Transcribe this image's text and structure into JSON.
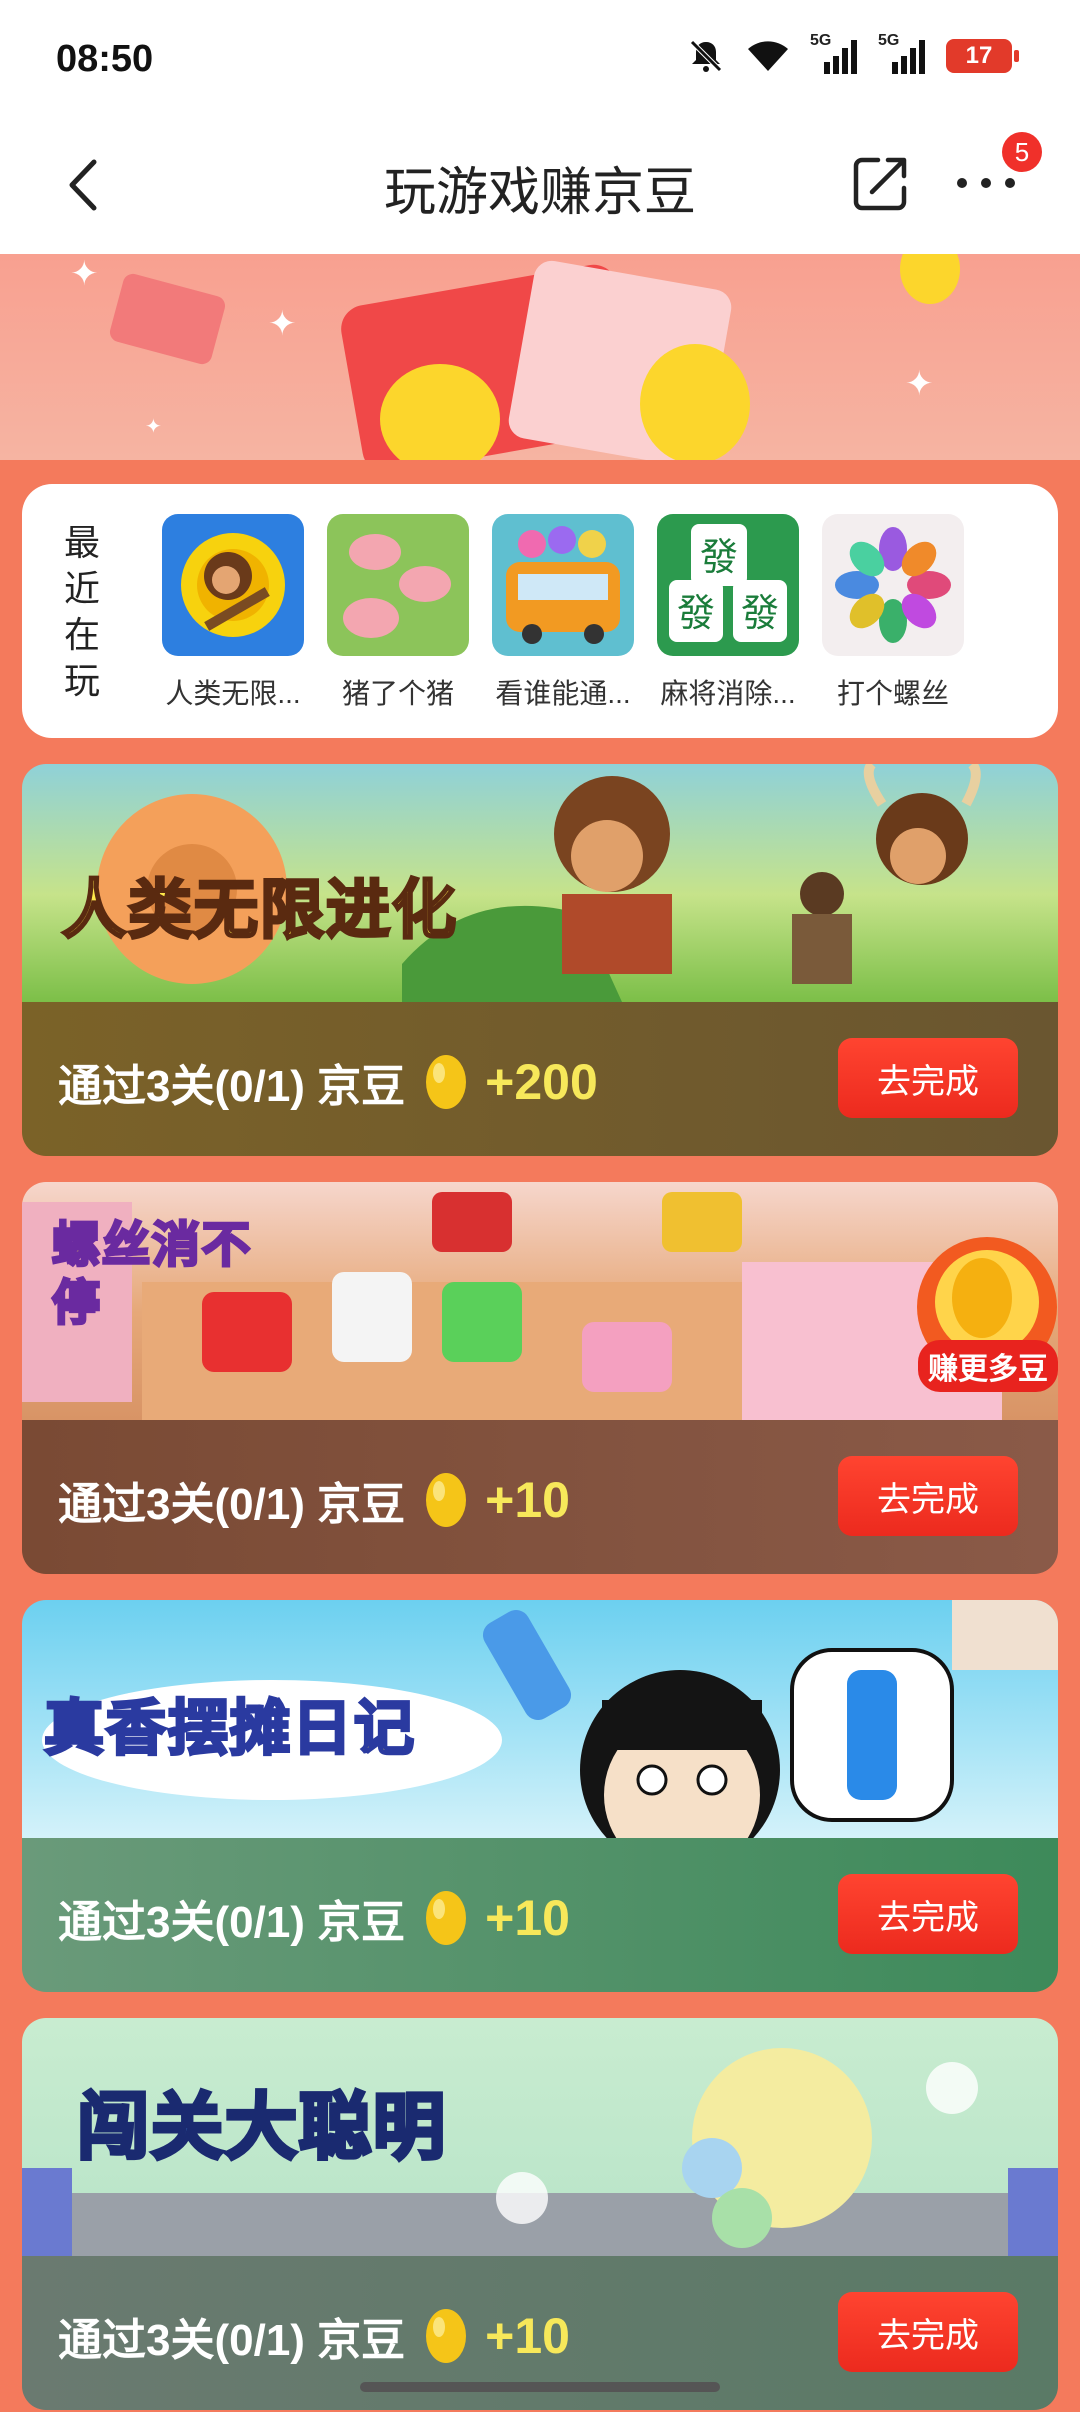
{
  "status_bar": {
    "time": "08:50",
    "signal_1": "5G",
    "signal_2": "5G",
    "battery": "17"
  },
  "nav": {
    "title": "玩游戏赚京豆",
    "more_badge": "5"
  },
  "recent": {
    "label": "最近在玩",
    "games": [
      {
        "name": "人类无限..."
      },
      {
        "name": "猪了个猪"
      },
      {
        "name": "看谁能通..."
      },
      {
        "name": "麻将消除..."
      },
      {
        "name": "打个螺丝"
      }
    ]
  },
  "tasks": [
    {
      "game_title": "人类无限进化",
      "text": "通过3关(0/1) 京豆",
      "reward": "+200",
      "button": "去完成",
      "color": "#7b5a28"
    },
    {
      "game_title": "螺丝消不停",
      "badge": "赚更多豆",
      "text": "通过3关(0/1) 京豆",
      "reward": "+10",
      "button": "去完成",
      "color": "#7a4a38"
    },
    {
      "game_title": "真香摆摊日记",
      "text": "通过3关(0/1) 京豆",
      "reward": "+10",
      "button": "去完成",
      "color": "#3f8a5e"
    },
    {
      "game_title": "闯关大聪明",
      "text": "通过3关(0/1) 京豆",
      "reward": "+10",
      "button": "去完成",
      "color": "#5d7a6a"
    }
  ]
}
